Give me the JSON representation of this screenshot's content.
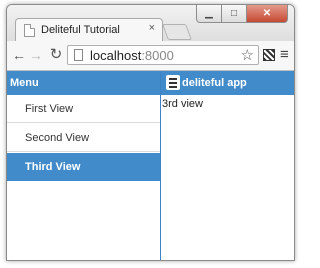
{
  "browser": {
    "tab_title": "Deliteful Tutorial",
    "tab_close": "×",
    "window_controls": {
      "minimize": "▁",
      "maximize": "□",
      "close": "✕"
    },
    "url_host": "localhost",
    "url_port": ":8000",
    "icons": {
      "back": "back-arrow-icon",
      "forward": "forward-arrow-icon",
      "reload": "reload-icon",
      "star": "bookmark-star-icon",
      "extension": "extension-icon",
      "menu": "chrome-menu-icon"
    }
  },
  "app": {
    "side_header": "Menu",
    "main_header": "deliteful app",
    "accent_color": "#428bca",
    "list": [
      {
        "label": "First View",
        "selected": false
      },
      {
        "label": "Second View",
        "selected": false
      },
      {
        "label": "Third View",
        "selected": true
      }
    ],
    "content_text": "3rd view"
  }
}
